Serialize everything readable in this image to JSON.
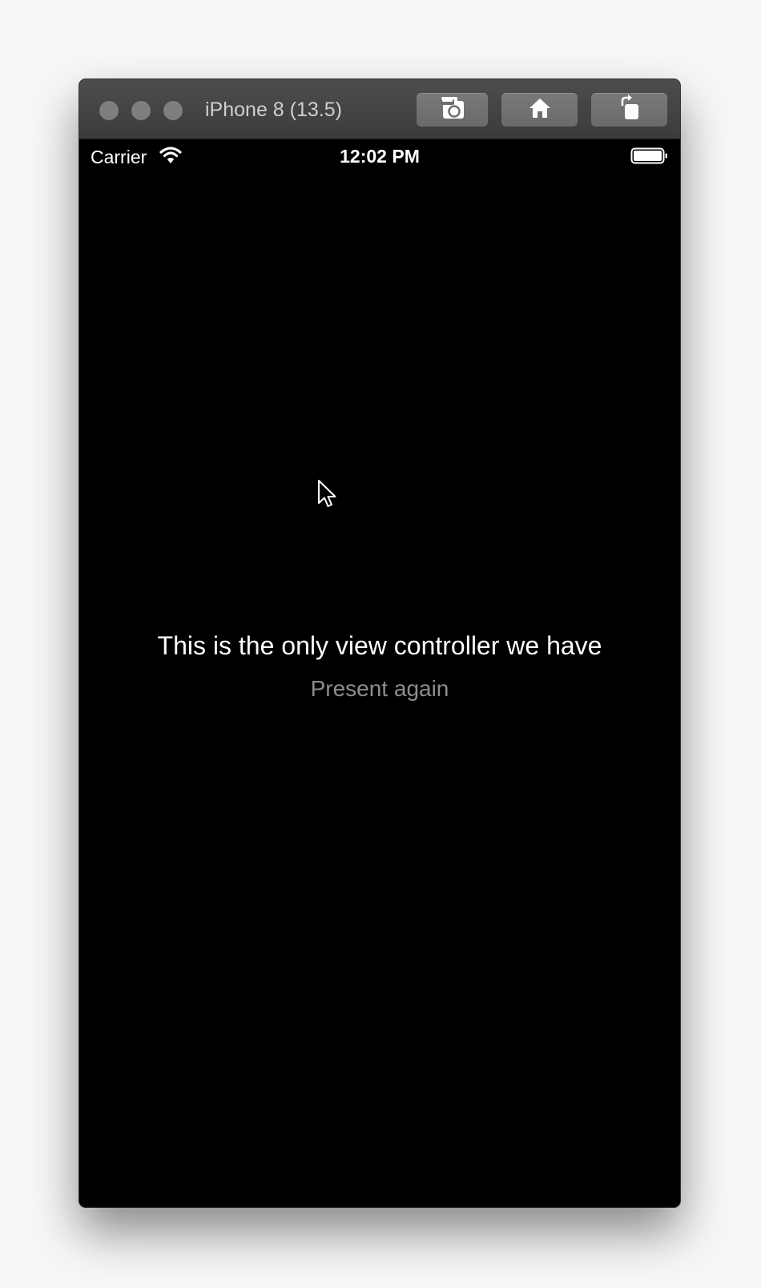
{
  "window": {
    "title": "iPhone 8 (13.5)",
    "toolbar": {
      "screenshot_icon": "camera-icon",
      "home_icon": "home-icon",
      "rotate_icon": "rotate-icon"
    }
  },
  "status_bar": {
    "carrier": "Carrier",
    "time": "12:02 PM",
    "wifi_icon": "wifi-icon",
    "battery_icon": "battery-icon"
  },
  "screen": {
    "headline": "This is the only view controller we have",
    "present_button": "Present again"
  },
  "colors": {
    "screen_background": "#000000",
    "headline_text": "#ffffff",
    "button_text": "#8d8d8d",
    "titlebar": "#444444"
  }
}
